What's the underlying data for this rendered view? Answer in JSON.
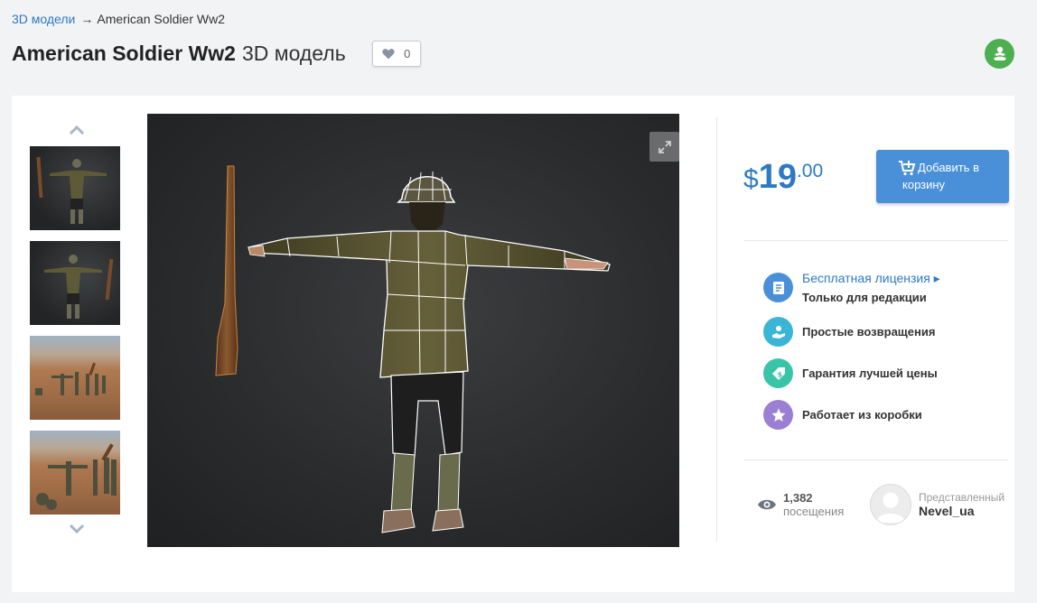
{
  "breadcrumb": {
    "parent": "3D модели",
    "arrow": "→",
    "current": "American Soldier Ww2"
  },
  "title": {
    "main": "American Soldier Ww2",
    "suffix": "3D модель"
  },
  "likes": {
    "count": "0"
  },
  "price": {
    "currency": "$",
    "integer": "19",
    "decimal": ".00"
  },
  "cart_button": {
    "line1": "Добавить в",
    "line2": "корзину"
  },
  "features": [
    {
      "icon": "document-icon",
      "link": "Бесплатная лицензия ▸",
      "label": "Только для редакции",
      "color": "#4a90d9"
    },
    {
      "icon": "hand-person-icon",
      "label": "Простые возвращения",
      "color": "#3bb5d6"
    },
    {
      "icon": "price-tag-icon",
      "label": "Гарантия лучшей цены",
      "color": "#39c4a8"
    },
    {
      "icon": "star-icon",
      "label": "Работает из коробки",
      "color": "#9b7fd4"
    }
  ],
  "stats": {
    "views": "1,382",
    "views_label": "посещения"
  },
  "author": {
    "label": "Представленный",
    "name": "Nevel_ua"
  },
  "colors": {
    "accent": "#2d7ac2",
    "button": "#4a90d9",
    "badge": "#4caf50"
  }
}
